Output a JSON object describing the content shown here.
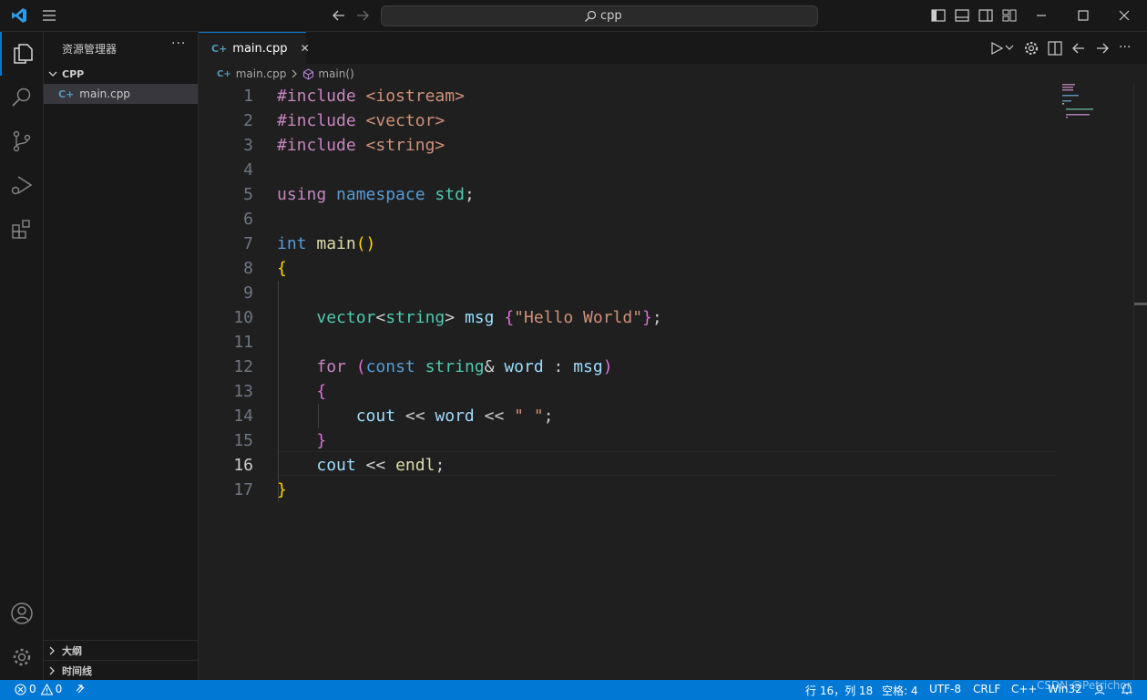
{
  "window": {
    "search_text": "cpp"
  },
  "sidebar": {
    "title": "资源管理器",
    "more": "···",
    "folder": "CPP",
    "file": "main.cpp",
    "panels": [
      "大纲",
      "时间线"
    ]
  },
  "editor": {
    "tab_label": "main.cpp",
    "tab_close": "✕",
    "breadcrumb": {
      "file": "main.cpp",
      "symbol": "main()"
    },
    "current_line": 16,
    "lines": [
      [
        [
          "#include",
          "kw"
        ],
        [
          " ",
          "pl"
        ],
        [
          "<iostream>",
          "inc"
        ]
      ],
      [
        [
          "#include",
          "kw"
        ],
        [
          " ",
          "pl"
        ],
        [
          "<vector>",
          "inc"
        ]
      ],
      [
        [
          "#include",
          "kw"
        ],
        [
          " ",
          "pl"
        ],
        [
          "<string>",
          "inc"
        ]
      ],
      [],
      [
        [
          "using",
          "kw"
        ],
        [
          " ",
          "pl"
        ],
        [
          "namespace",
          "bl"
        ],
        [
          " ",
          "pl"
        ],
        [
          "std",
          "ty"
        ],
        [
          ";",
          "pl"
        ]
      ],
      [],
      [
        [
          "int",
          "bl"
        ],
        [
          " ",
          "pl"
        ],
        [
          "main",
          "fn"
        ],
        [
          "()",
          "b1"
        ]
      ],
      [
        [
          "{",
          "b1"
        ]
      ],
      [],
      [
        [
          "    ",
          "pl"
        ],
        [
          "vector",
          "ty"
        ],
        [
          "<",
          "pl"
        ],
        [
          "string",
          "ty"
        ],
        [
          "> ",
          "pl"
        ],
        [
          "msg",
          "var"
        ],
        [
          " ",
          "pl"
        ],
        [
          "{",
          "b2"
        ],
        [
          "\"Hello World\"",
          "str"
        ],
        [
          "}",
          "b2"
        ],
        [
          ";",
          "pl"
        ]
      ],
      [],
      [
        [
          "    ",
          "pl"
        ],
        [
          "for",
          "kw"
        ],
        [
          " ",
          "pl"
        ],
        [
          "(",
          "b2"
        ],
        [
          "const",
          "bl"
        ],
        [
          " ",
          "pl"
        ],
        [
          "string",
          "ty"
        ],
        [
          "& ",
          "pl"
        ],
        [
          "word",
          "var"
        ],
        [
          " : ",
          "pl"
        ],
        [
          "msg",
          "var"
        ],
        [
          ")",
          "b2"
        ]
      ],
      [
        [
          "    ",
          "pl"
        ],
        [
          "{",
          "b2"
        ]
      ],
      [
        [
          "        ",
          "pl"
        ],
        [
          "cout",
          "var"
        ],
        [
          " << ",
          "pl"
        ],
        [
          "word",
          "var"
        ],
        [
          " << ",
          "pl"
        ],
        [
          "\" \"",
          "str"
        ],
        [
          ";",
          "pl"
        ]
      ],
      [
        [
          "    ",
          "pl"
        ],
        [
          "}",
          "b2"
        ]
      ],
      [
        [
          "    ",
          "pl"
        ],
        [
          "cout",
          "var"
        ],
        [
          " << ",
          "pl"
        ],
        [
          "endl",
          "fn"
        ],
        [
          ";",
          "pl"
        ]
      ],
      [
        [
          "}",
          "b1"
        ]
      ]
    ]
  },
  "statusbar": {
    "errors": "0",
    "warnings": "0",
    "position": "行 16，列 18",
    "indent": "空格: 4",
    "encoding": "UTF-8",
    "eol": "CRLF",
    "language": "C++",
    "platform": "Win32",
    "watermark": "CSDN @Petrichor"
  },
  "colors": {
    "accent": "#0078d4",
    "cpp_icon": "#519aba",
    "keyword": "#c586c0",
    "type": "#4ec9b0",
    "string": "#ce9178",
    "variable": "#9cdcfe",
    "function": "#dcdcaa"
  },
  "icons": [
    "vscode-logo-icon",
    "menu-icon",
    "back-arrow-icon",
    "forward-arrow-icon",
    "search-icon",
    "toggle-sidebar-icon",
    "toggle-panel-icon",
    "toggle-secondary-sidebar-icon",
    "customize-layout-icon",
    "minimize-icon",
    "maximize-icon",
    "close-icon",
    "explorer-icon",
    "search-view-icon",
    "source-control-icon",
    "run-debug-icon",
    "extensions-icon",
    "account-icon",
    "manage-gear-icon",
    "run-icon",
    "settings-icon",
    "split-editor-icon",
    "error-icon",
    "warning-icon",
    "remote-icon",
    "feedback-icon",
    "bell-icon"
  ]
}
